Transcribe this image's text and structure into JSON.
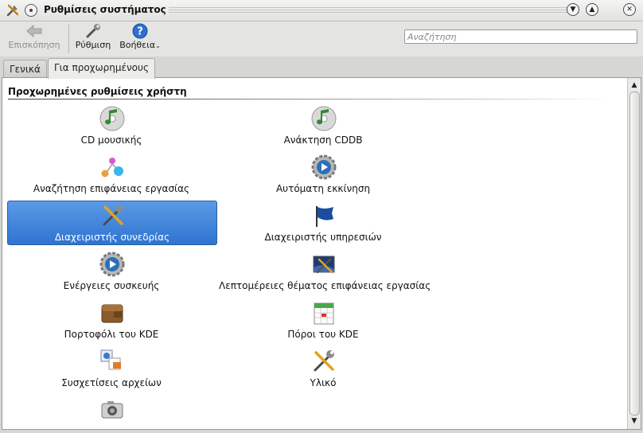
{
  "window": {
    "title": "Ρυθμίσεις συστήματος",
    "app_icon": "tools-icon",
    "controls": [
      "minimize-icon",
      "maximize-icon",
      "close-icon"
    ]
  },
  "toolbar": {
    "overview_label": "Επισκόπηση",
    "configure_label": "Ρύθμιση",
    "help_label": "Βοήθεια",
    "search_placeholder": "Αναζήτηση"
  },
  "tabs": [
    {
      "label": "Γενικά",
      "active": false
    },
    {
      "label": "Για προχωρημένους",
      "active": true
    }
  ],
  "section": {
    "title": "Προχωρημένες ρυθμίσεις χρήστη"
  },
  "items": [
    {
      "label": "CD μουσικής",
      "icon": "audio-cd-icon"
    },
    {
      "label": "Ανάκτηση CDDB",
      "icon": "cddb-icon"
    },
    {
      "label": "Αναζήτηση επιφάνειας εργασίας",
      "icon": "desktop-search-icon"
    },
    {
      "label": "Αυτόματη εκκίνηση",
      "icon": "autostart-icon"
    },
    {
      "label": "Διαχειριστής συνεδρίας",
      "icon": "session-manager-icon",
      "selected": true
    },
    {
      "label": "Διαχειριστής υπηρεσιών",
      "icon": "service-manager-icon"
    },
    {
      "label": "Ενέργειες συσκευής",
      "icon": "device-actions-icon"
    },
    {
      "label": "Λεπτομέρειες θέματος επιφάνειας εργασίας",
      "icon": "desktop-theme-icon"
    },
    {
      "label": "Πορτοφόλι του KDE",
      "icon": "kde-wallet-icon"
    },
    {
      "label": "Πόροι του KDE",
      "icon": "kde-resources-icon"
    },
    {
      "label": "Συσχετίσεις αρχείων",
      "icon": "file-associations-icon"
    },
    {
      "label": "Υλικό",
      "icon": "hardware-icon"
    },
    {
      "label": "",
      "icon": "camera-icon"
    }
  ],
  "colors": {
    "selection": "#3b82d8",
    "content_bg": "#ffffff",
    "chrome_bg": "#d6d6d4"
  }
}
